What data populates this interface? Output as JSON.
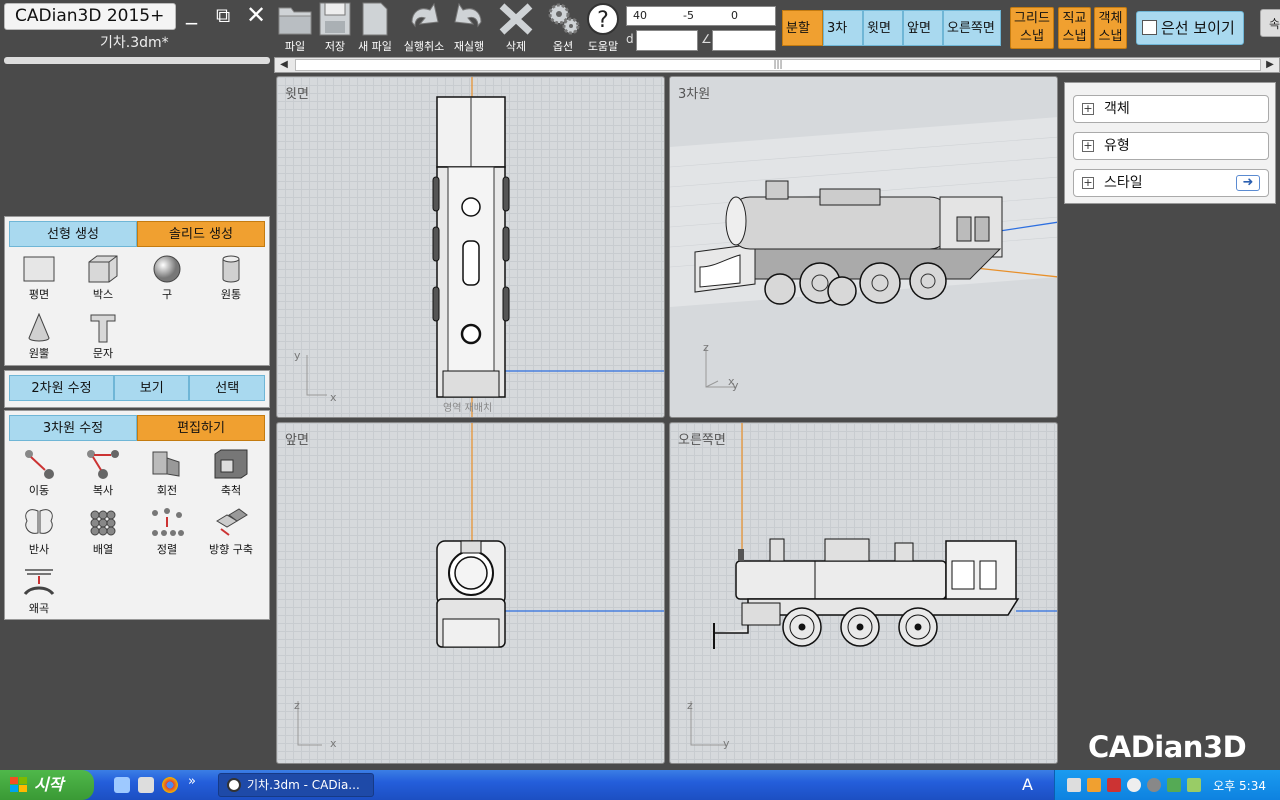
{
  "app": {
    "title": "CADian3D 2015+",
    "filename": "기차.3dm*",
    "minimize_glyph": "_",
    "restore_glyph": "⧉",
    "close_glyph": "✕"
  },
  "toolbar": {
    "file_label": "파일",
    "save_label": "저장",
    "new_file_label": "새 파일",
    "undo_label": "실행취소",
    "redo_label": "재실행",
    "delete_label": "삭제",
    "options_label": "옵션",
    "help_label": "도움말"
  },
  "coords": {
    "x": "40",
    "y": "-5",
    "z": "0",
    "dist_symbol": "d",
    "angle_symbol": "∠"
  },
  "view_tabs": [
    {
      "label": "분할"
    },
    {
      "label": "3차원"
    },
    {
      "label": "윗면"
    },
    {
      "label": "앞면"
    },
    {
      "label": "오른쪽면"
    }
  ],
  "snaps": {
    "grid_l1": "그리드",
    "grid_l2": "스냅",
    "ortho_l1": "직교",
    "ortho_l2": "스냅",
    "object_l1": "객체",
    "object_l2": "스냅"
  },
  "hidden_toggle": {
    "label": "은선 보이기",
    "checked": false
  },
  "edge_button": {
    "label": "속"
  },
  "left_panel": {
    "create_tabs": [
      {
        "label": "선형 생성"
      },
      {
        "label": "솔리드 생성"
      }
    ],
    "solid_tools": [
      {
        "label": "평면",
        "icon": "plane-icon"
      },
      {
        "label": "박스",
        "icon": "box-icon"
      },
      {
        "label": "구",
        "icon": "sphere-icon"
      },
      {
        "label": "원통",
        "icon": "cylinder-icon"
      },
      {
        "label": "원뿔",
        "icon": "cone-icon"
      },
      {
        "label": "문자",
        "icon": "text-icon"
      }
    ],
    "modify_tabs": [
      {
        "label": "2차원 수정"
      },
      {
        "label": "보기"
      },
      {
        "label": "선택"
      }
    ],
    "edit_tabs": [
      {
        "label": "3차원 수정"
      },
      {
        "label": "편집하기"
      }
    ],
    "edit_tools": [
      {
        "label": "이동",
        "icon": "move-icon"
      },
      {
        "label": "복사",
        "icon": "copy-icon"
      },
      {
        "label": "회전",
        "icon": "rotate-icon"
      },
      {
        "label": "축척",
        "icon": "scale-icon"
      },
      {
        "label": "반사",
        "icon": "mirror-icon"
      },
      {
        "label": "배열",
        "icon": "array-icon"
      },
      {
        "label": "정렬",
        "icon": "align-icon"
      },
      {
        "label": "방향 구축",
        "icon": "orient-icon"
      },
      {
        "label": "왜곡",
        "icon": "distort-icon"
      }
    ]
  },
  "scrollbar": {
    "thumb_grip": "|||"
  },
  "viewports": {
    "top": {
      "title": "윗면",
      "axis_v": "y",
      "axis_h": "x",
      "region_label": "영역 재배치"
    },
    "persp": {
      "title": "3차원",
      "axis_v": "z",
      "axis_h": "y",
      "axis_d": "x"
    },
    "front": {
      "title": "앞면",
      "axis_v": "z",
      "axis_h": "x"
    },
    "right": {
      "title": "오른쪽면",
      "axis_v": "z",
      "axis_h": "y"
    }
  },
  "right_panel": {
    "items": [
      {
        "label": "객체"
      },
      {
        "label": "유형"
      },
      {
        "label": "스타일"
      }
    ],
    "expand_glyph": "+",
    "go_glyph": "➜"
  },
  "logo": {
    "text": "CADian3D"
  },
  "taskbar": {
    "start_label": "시작",
    "overflow_glyph": "»",
    "task_label": "기차.3dm - CADia...",
    "lang_indicator": "A",
    "clock": "오후 5:34"
  },
  "colors": {
    "accent_orange": "#f0a030",
    "accent_blue": "#a9d9ef",
    "axis_orange": "#e8902a",
    "axis_blue": "#2d6fe0"
  }
}
